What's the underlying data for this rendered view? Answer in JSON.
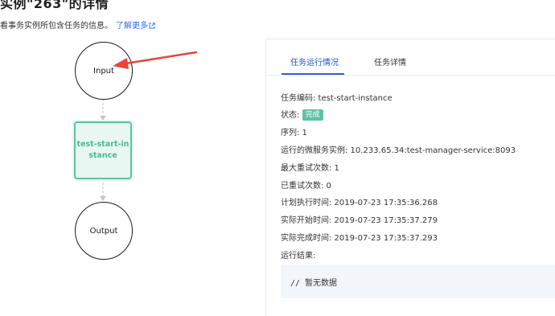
{
  "header": {
    "title": "实例\"263\"的详情",
    "subtitle": "看事务实例所包含任务的信息。",
    "learn_more": "了解更多"
  },
  "flow": {
    "input_label": "Input",
    "task_label_line1": "test-start-in",
    "task_label_line2": "stance",
    "output_label": "Output"
  },
  "tabs": [
    {
      "label": "任务运行情况",
      "active": true
    },
    {
      "label": "任务详情",
      "active": false
    }
  ],
  "details": {
    "task_code": "任务编码: test-start-instance",
    "status_label": "状态:",
    "status_value": "完成",
    "sequence": "序列: 1",
    "service_instance": "运行的微服务实例: 10.233.65.34:test-manager-service:8093",
    "max_retry": "最大重试次数: 1",
    "retried": "已重试次数: 0",
    "planned_time": "计划执行时间: 2019-07-23 17:35:36.268",
    "actual_start": "实际开始时间: 2019-07-23 17:35:37.279",
    "actual_finish": "实际完成时间: 2019-07-23 17:35:37.293",
    "result_label": "运行结果:",
    "result_value": "// 暂无数据"
  },
  "colors": {
    "accent": "#2f5fce",
    "status_green": "#5cc3a3",
    "annotation_arrow": "#e8453c"
  }
}
